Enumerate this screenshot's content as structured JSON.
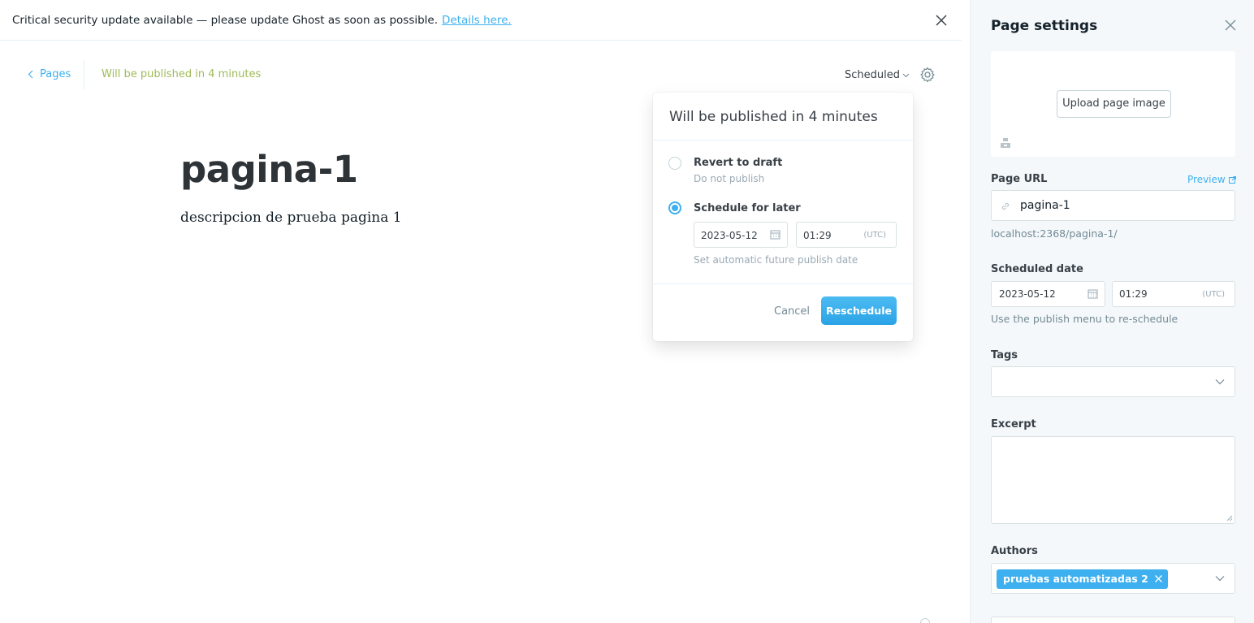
{
  "alert": {
    "message": "Critical security update available — please update Ghost as soon as possible.",
    "link": "Details here."
  },
  "editor": {
    "back_label": "Pages",
    "status": "Will be published in 4 minutes",
    "status_menu": "Scheduled",
    "title": "pagina-1",
    "description": "descripcion de prueba pagina 1"
  },
  "popover": {
    "heading": "Will be published in 4 minutes",
    "option1_label": "Revert to draft",
    "option1_sub": "Do not publish",
    "option2_label": "Schedule for later",
    "date": "2023-05-12",
    "time": "01:29",
    "tz": "(UTC)",
    "hint": "Set automatic future publish date",
    "cancel": "Cancel",
    "confirm": "Reschedule",
    "selected_option": "Schedule for later"
  },
  "settings": {
    "title": "Page settings",
    "upload_label": "Upload page image",
    "url_label": "Page URL",
    "preview_label": "Preview",
    "slug": "pagina-1",
    "url_hint": "localhost:2368/pagina-1/",
    "sched_label": "Scheduled date",
    "sched_date": "2023-05-12",
    "sched_time": "01:29",
    "sched_tz": "(UTC)",
    "sched_hint": "Use the publish menu to re-schedule",
    "tags_label": "Tags",
    "excerpt_label": "Excerpt",
    "authors_label": "Authors",
    "author": "pruebas automatizadas 2"
  },
  "colors": {
    "accent": "#3eb0ef",
    "scheduled_green": "#9fbb58"
  }
}
